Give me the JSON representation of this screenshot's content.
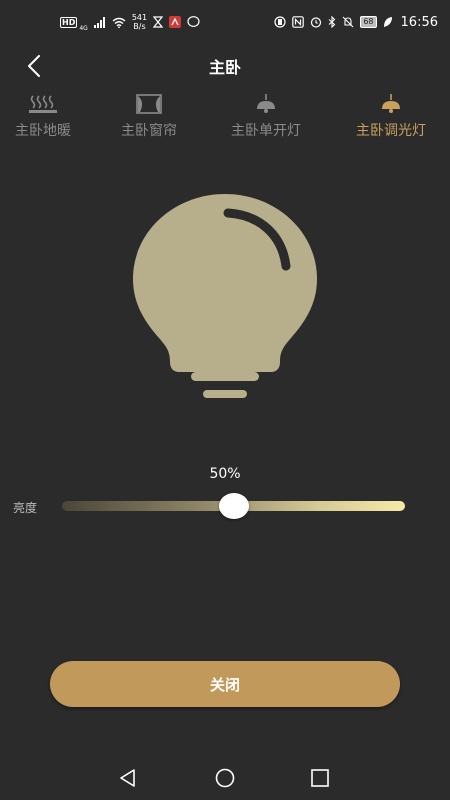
{
  "status_bar": {
    "hd": "HD",
    "net": "4G",
    "speed_value": "541",
    "speed_unit": "B/s",
    "battery": "68",
    "time": "16:56"
  },
  "header": {
    "title": "主卧"
  },
  "tabs": [
    {
      "label": "主卧地暖",
      "icon": "floor-heating-icon",
      "active": false
    },
    {
      "label": "主卧窗帘",
      "icon": "curtain-icon",
      "active": false
    },
    {
      "label": "主卧单开灯",
      "icon": "ceiling-lamp-icon",
      "active": false
    },
    {
      "label": "主卧调光灯",
      "icon": "dimmer-lamp-icon",
      "active": true
    }
  ],
  "brightness": {
    "label": "亮度",
    "percent_text": "50%",
    "value": 50
  },
  "actions": {
    "off_label": "关闭"
  },
  "colors": {
    "background": "#2b2b2b",
    "accent": "#c19a5b",
    "active_tab": "#c9a05e",
    "inactive_tab": "#8a8a8a",
    "bulb": "#b7ae8b",
    "slider_start": "#4a4638",
    "slider_end": "#f6e9a7"
  }
}
